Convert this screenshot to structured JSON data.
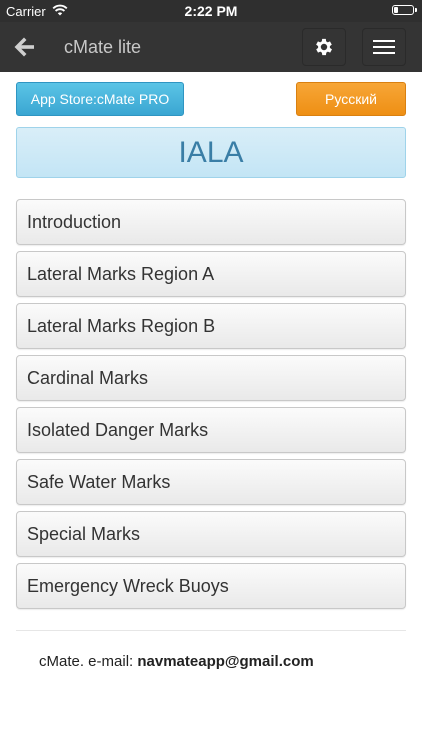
{
  "status_bar": {
    "carrier": "Carrier",
    "time": "2:22 PM"
  },
  "nav": {
    "title": "cMate lite",
    "icons": [
      "back-arrow-icon",
      "gear-icon",
      "hamburger-menu-icon"
    ]
  },
  "buttons": {
    "store_label": "App Store:cMate PRO",
    "language_label": "Русский"
  },
  "header": {
    "title": "IALA"
  },
  "menu_items": [
    "Introduction",
    "Lateral Marks Region A",
    "Lateral Marks Region B",
    "Cardinal Marks",
    "Isolated Danger Marks",
    "Safe Water Marks",
    "Special Marks",
    "Emergency Wreck Buoys"
  ],
  "footer": {
    "prefix": "cMate. e-mail: ",
    "email": "navmateapp@gmail.com"
  },
  "colors": {
    "nav_bg": "#343434",
    "store_button": "#3aa6d2",
    "language_button": "#ee8f14",
    "header_bg": "#c3e5f5",
    "header_text": "#3a7ea6"
  }
}
